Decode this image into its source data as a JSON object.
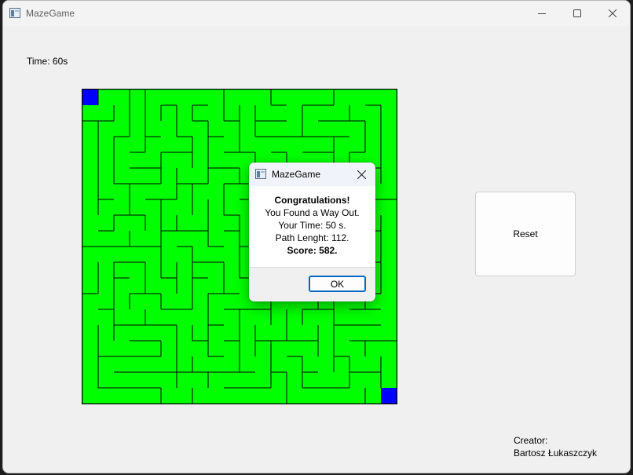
{
  "window": {
    "title": "MazeGame",
    "app_icon": "window-app-icon"
  },
  "caption_buttons": {
    "minimize_icon": "minimize-icon",
    "maximize_icon": "maximize-icon",
    "close_icon": "close-icon"
  },
  "timer": {
    "label": "Time: 60s"
  },
  "maze": {
    "cols": 20,
    "rows": 20,
    "colors": {
      "floor": "#00ff00",
      "wall": "#000000",
      "start": "#0000ff",
      "exit": "#0000ff"
    },
    "start_cell": [
      0,
      0
    ],
    "exit_cell": [
      19,
      19
    ]
  },
  "reset_button": {
    "label": "Reset"
  },
  "creator": {
    "heading": "Creator:",
    "name": "Bartosz Łukaszczyk"
  },
  "dialog": {
    "title": "MazeGame",
    "lines": [
      "Congratulations!",
      "You Found a Way Out.",
      "Your Time: 50 s.",
      "Path Lenght: 112.",
      "Score: 582."
    ],
    "ok_label": "OK"
  }
}
